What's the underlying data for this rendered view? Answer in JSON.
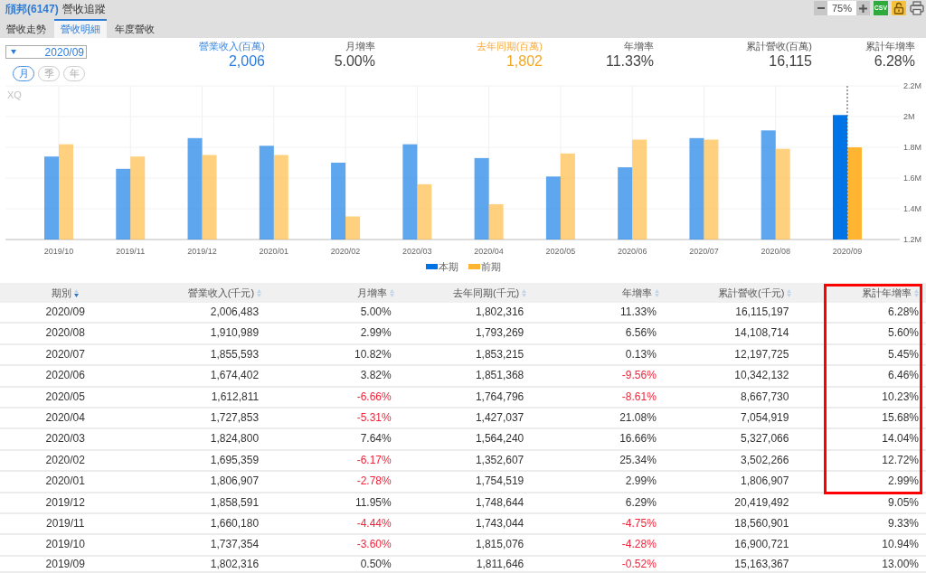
{
  "header": {
    "stock": "頎邦(6147)",
    "title": "營收追蹤",
    "toolbar": {
      "zoom": "75%",
      "export": "CSV"
    }
  },
  "tabs": [
    {
      "label": "營收走勢",
      "selected": false
    },
    {
      "label": "營收明細",
      "selected": true
    },
    {
      "label": "年度營收",
      "selected": false
    }
  ],
  "period_select": {
    "value": "2020/09"
  },
  "frequency": [
    {
      "label": "月",
      "selected": true
    },
    {
      "label": "季",
      "selected": false
    },
    {
      "label": "年",
      "selected": false
    }
  ],
  "summary": [
    {
      "label": "營業收入(百萬)",
      "value": "2,006",
      "kind": "current"
    },
    {
      "label": "月增率",
      "value": "5.00%",
      "kind": "plain"
    },
    {
      "label": "去年同期(百萬)",
      "value": "1,802",
      "kind": "previous"
    },
    {
      "label": "年增率",
      "value": "11.33%",
      "kind": "plain"
    },
    {
      "label": "累計營收(百萬)",
      "value": "16,115",
      "kind": "plain"
    },
    {
      "label": "累計年增率",
      "value": "6.28%",
      "kind": "plain"
    }
  ],
  "chart": {
    "logo": "XQ",
    "chart_data": {
      "type": "bar",
      "categories": [
        "2019/10",
        "2019/11",
        "2019/12",
        "2020/01",
        "2020/02",
        "2020/03",
        "2020/04",
        "2020/05",
        "2020/06",
        "2020/07",
        "2020/08",
        "2020/09"
      ],
      "series": [
        {
          "name": "本期",
          "color": "#0073e6",
          "values": [
            1740000,
            1660000,
            1860000,
            1810000,
            1700000,
            1820000,
            1730000,
            1610000,
            1670000,
            1860000,
            1910000,
            2010000
          ]
        },
        {
          "name": "前期",
          "color": "#ffb531",
          "values": [
            1820000,
            1740000,
            1750000,
            1750000,
            1350000,
            1560000,
            1430000,
            1760000,
            1850000,
            1850000,
            1790000,
            1800000
          ]
        }
      ],
      "ylim": [
        1200000,
        2200000
      ],
      "yticks": [
        {
          "value": 1200000,
          "label": "1.2M"
        },
        {
          "value": 1400000,
          "label": "1.4M"
        },
        {
          "value": 1600000,
          "label": "1.6M"
        },
        {
          "value": 1800000,
          "label": "1.8M"
        },
        {
          "value": 2000000,
          "label": "2M"
        },
        {
          "value": 2200000,
          "label": "2.2M"
        }
      ],
      "grid": true,
      "legend": true,
      "ref_lines": [
        {
          "axis": "x",
          "value": "2020/09"
        }
      ]
    }
  },
  "table": {
    "columns": [
      {
        "label": "期別",
        "sorted": true,
        "highlighted": false
      },
      {
        "label": "營業收入(千元)",
        "sorted": false,
        "highlighted": false
      },
      {
        "label": "月增率",
        "sorted": false,
        "highlighted": false
      },
      {
        "label": "去年同期(千元)",
        "sorted": false,
        "highlighted": false
      },
      {
        "label": "年增率",
        "sorted": false,
        "highlighted": false
      },
      {
        "label": "累計營收(千元)",
        "sorted": false,
        "highlighted": false
      },
      {
        "label": "累計年增率",
        "sorted": false,
        "highlighted": true
      }
    ],
    "rows": [
      {
        "highlighted": true,
        "cells": [
          {
            "text": "2020/09",
            "negative": false
          },
          {
            "text": "2,006,483",
            "negative": false
          },
          {
            "text": "5.00%",
            "negative": false
          },
          {
            "text": "1,802,316",
            "negative": false
          },
          {
            "text": "11.33%",
            "negative": false
          },
          {
            "text": "16,115,197",
            "negative": false
          },
          {
            "text": "6.28%",
            "negative": false
          }
        ]
      },
      {
        "highlighted": true,
        "cells": [
          {
            "text": "2020/08",
            "negative": false
          },
          {
            "text": "1,910,989",
            "negative": false
          },
          {
            "text": "2.99%",
            "negative": false
          },
          {
            "text": "1,793,269",
            "negative": false
          },
          {
            "text": "6.56%",
            "negative": false
          },
          {
            "text": "14,108,714",
            "negative": false
          },
          {
            "text": "5.60%",
            "negative": false
          }
        ]
      },
      {
        "highlighted": true,
        "cells": [
          {
            "text": "2020/07",
            "negative": false
          },
          {
            "text": "1,855,593",
            "negative": false
          },
          {
            "text": "10.82%",
            "negative": false
          },
          {
            "text": "1,853,215",
            "negative": false
          },
          {
            "text": "0.13%",
            "negative": false
          },
          {
            "text": "12,197,725",
            "negative": false
          },
          {
            "text": "5.45%",
            "negative": false
          }
        ]
      },
      {
        "highlighted": true,
        "cells": [
          {
            "text": "2020/06",
            "negative": false
          },
          {
            "text": "1,674,402",
            "negative": false
          },
          {
            "text": "3.82%",
            "negative": false
          },
          {
            "text": "1,851,368",
            "negative": false
          },
          {
            "text": "-9.56%",
            "negative": true
          },
          {
            "text": "10,342,132",
            "negative": false
          },
          {
            "text": "6.46%",
            "negative": false
          }
        ]
      },
      {
        "highlighted": true,
        "cells": [
          {
            "text": "2020/05",
            "negative": false
          },
          {
            "text": "1,612,811",
            "negative": false
          },
          {
            "text": "-6.66%",
            "negative": true
          },
          {
            "text": "1,764,796",
            "negative": false
          },
          {
            "text": "-8.61%",
            "negative": true
          },
          {
            "text": "8,667,730",
            "negative": false
          },
          {
            "text": "10.23%",
            "negative": false
          }
        ]
      },
      {
        "highlighted": true,
        "cells": [
          {
            "text": "2020/04",
            "negative": false
          },
          {
            "text": "1,727,853",
            "negative": false
          },
          {
            "text": "-5.31%",
            "negative": true
          },
          {
            "text": "1,427,037",
            "negative": false
          },
          {
            "text": "21.08%",
            "negative": false
          },
          {
            "text": "7,054,919",
            "negative": false
          },
          {
            "text": "15.68%",
            "negative": false
          }
        ]
      },
      {
        "highlighted": true,
        "cells": [
          {
            "text": "2020/03",
            "negative": false
          },
          {
            "text": "1,824,800",
            "negative": false
          },
          {
            "text": "7.64%",
            "negative": false
          },
          {
            "text": "1,564,240",
            "negative": false
          },
          {
            "text": "16.66%",
            "negative": false
          },
          {
            "text": "5,327,066",
            "negative": false
          },
          {
            "text": "14.04%",
            "negative": false
          }
        ]
      },
      {
        "highlighted": true,
        "cells": [
          {
            "text": "2020/02",
            "negative": false
          },
          {
            "text": "1,695,359",
            "negative": false
          },
          {
            "text": "-6.17%",
            "negative": true
          },
          {
            "text": "1,352,607",
            "negative": false
          },
          {
            "text": "25.34%",
            "negative": false
          },
          {
            "text": "3,502,266",
            "negative": false
          },
          {
            "text": "12.72%",
            "negative": false
          }
        ]
      },
      {
        "highlighted": true,
        "cells": [
          {
            "text": "2020/01",
            "negative": false
          },
          {
            "text": "1,806,907",
            "negative": false
          },
          {
            "text": "-2.78%",
            "negative": true
          },
          {
            "text": "1,754,519",
            "negative": false
          },
          {
            "text": "2.99%",
            "negative": false
          },
          {
            "text": "1,806,907",
            "negative": false
          },
          {
            "text": "2.99%",
            "negative": false
          }
        ]
      },
      {
        "highlighted": false,
        "cells": [
          {
            "text": "2019/12",
            "negative": false
          },
          {
            "text": "1,858,591",
            "negative": false
          },
          {
            "text": "11.95%",
            "negative": false
          },
          {
            "text": "1,748,644",
            "negative": false
          },
          {
            "text": "6.29%",
            "negative": false
          },
          {
            "text": "20,419,492",
            "negative": false
          },
          {
            "text": "9.05%",
            "negative": false
          }
        ]
      },
      {
        "highlighted": false,
        "cells": [
          {
            "text": "2019/11",
            "negative": false
          },
          {
            "text": "1,660,180",
            "negative": false
          },
          {
            "text": "-4.44%",
            "negative": true
          },
          {
            "text": "1,743,044",
            "negative": false
          },
          {
            "text": "-4.75%",
            "negative": true
          },
          {
            "text": "18,560,901",
            "negative": false
          },
          {
            "text": "9.33%",
            "negative": false
          }
        ]
      },
      {
        "highlighted": false,
        "cells": [
          {
            "text": "2019/10",
            "negative": false
          },
          {
            "text": "1,737,354",
            "negative": false
          },
          {
            "text": "-3.60%",
            "negative": true
          },
          {
            "text": "1,815,076",
            "negative": false
          },
          {
            "text": "-4.28%",
            "negative": true
          },
          {
            "text": "16,900,721",
            "negative": false
          },
          {
            "text": "10.94%",
            "negative": false
          }
        ]
      },
      {
        "highlighted": false,
        "cells": [
          {
            "text": "2019/09",
            "negative": false
          },
          {
            "text": "1,802,316",
            "negative": false
          },
          {
            "text": "0.50%",
            "negative": false
          },
          {
            "text": "1,811,646",
            "negative": false
          },
          {
            "text": "-0.52%",
            "negative": true
          },
          {
            "text": "15,163,367",
            "negative": false
          },
          {
            "text": "13.00%",
            "negative": false
          }
        ]
      }
    ]
  }
}
